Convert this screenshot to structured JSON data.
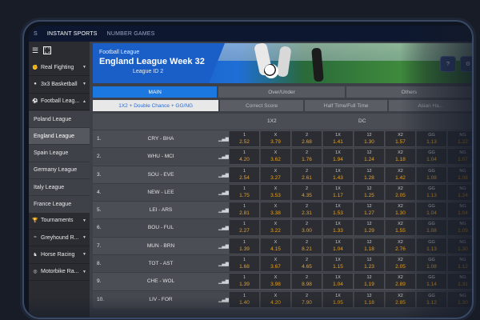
{
  "topbar": {
    "tabs": [
      {
        "label": "S"
      },
      {
        "label": "INSTANT SPORTS"
      },
      {
        "label": "NUMBER GAMES"
      }
    ]
  },
  "sidebar": {
    "items": [
      {
        "label": "Real Fighting",
        "icon": "fist-icon",
        "kind": "sport"
      },
      {
        "label": "3x3 Basketball",
        "icon": "basketball-icon",
        "kind": "sport"
      },
      {
        "label": "Football Leag...",
        "icon": "football-icon",
        "kind": "sport"
      },
      {
        "label": "Poland League",
        "kind": "sub"
      },
      {
        "label": "England League",
        "kind": "sub-active"
      },
      {
        "label": "Spain League",
        "kind": "sub"
      },
      {
        "label": "Germany League",
        "kind": "sub"
      },
      {
        "label": "Italy League",
        "kind": "sub"
      },
      {
        "label": "France League",
        "kind": "sub"
      },
      {
        "label": "Tournaments",
        "icon": "trophy-icon",
        "kind": "sport"
      },
      {
        "label": "Greyhound R...",
        "icon": "greyhound-icon",
        "kind": "sport"
      },
      {
        "label": "Horse Racing",
        "icon": "horse-icon",
        "kind": "sport"
      },
      {
        "label": "Motorbike Ra...",
        "icon": "motorbike-icon",
        "kind": "sport"
      }
    ]
  },
  "banner": {
    "subtitle": "Football League",
    "title": "England League Week 32",
    "league_id": "League ID 2",
    "help_label": "?"
  },
  "main_tabs": [
    {
      "label": "MAIN"
    },
    {
      "label": "Over/Under"
    },
    {
      "label": "Others"
    }
  ],
  "sub_tabs": [
    {
      "label": "1X2 + Double Chance + GG/NG"
    },
    {
      "label": "Correct Score"
    },
    {
      "label": "Half Time/Full Time"
    },
    {
      "label": "Asian Ha..."
    }
  ],
  "grid": {
    "headers": {
      "g1": "1X2",
      "g2": "DC"
    },
    "rows": [
      {
        "num": "1.",
        "match": "CRY - BHA",
        "odds": [
          "2.52",
          "3.79",
          "2.68",
          "1.41",
          "1.30",
          "1.57",
          "1.13",
          "1.22"
        ],
        "labels": [
          "1",
          "X",
          "2",
          "1X",
          "12",
          "X2",
          "GG",
          "NG"
        ]
      },
      {
        "num": "2.",
        "match": "WHU - MCI",
        "odds": [
          "4.20",
          "3.62",
          "1.76",
          "1.94",
          "1.24",
          "1.18",
          "1.04",
          "1.07"
        ],
        "labels": [
          "1",
          "X",
          "2",
          "1X",
          "12",
          "X2",
          "GG",
          "NG"
        ]
      },
      {
        "num": "3.",
        "match": "SOU - EVE",
        "odds": [
          "2.54",
          "3.27",
          "2.61",
          "1.43",
          "1.28",
          "1.42",
          "1.08",
          "1.08"
        ],
        "labels": [
          "1",
          "X",
          "2",
          "1X",
          "12",
          "X2",
          "GG",
          "NG"
        ]
      },
      {
        "num": "4.",
        "match": "NEW - LEE",
        "odds": [
          "1.75",
          "3.53",
          "4.35",
          "1.17",
          "1.25",
          "2.05",
          "1.13",
          "1.24"
        ],
        "labels": [
          "1",
          "X",
          "2",
          "1X",
          "12",
          "X2",
          "GG",
          "NG"
        ]
      },
      {
        "num": "5.",
        "match": "LEI - ARS",
        "odds": [
          "2.81",
          "3.38",
          "2.31",
          "1.53",
          "1.27",
          "1.30",
          "1.04",
          "1.04"
        ],
        "labels": [
          "1",
          "X",
          "2",
          "1X",
          "12",
          "X2",
          "GG",
          "NG"
        ]
      },
      {
        "num": "6.",
        "match": "BOU - FUL",
        "odds": [
          "2.27",
          "3.22",
          "3.00",
          "1.33",
          "1.29",
          "1.55",
          "1.08",
          "1.09"
        ],
        "labels": [
          "1",
          "X",
          "2",
          "1X",
          "12",
          "X2",
          "GG",
          "NG"
        ]
      },
      {
        "num": "7.",
        "match": "MUN - BRN",
        "odds": [
          "1.39",
          "4.15",
          "8.21",
          "1.04",
          "1.18",
          "2.76",
          "1.13",
          "1.30"
        ],
        "labels": [
          "1",
          "X",
          "2",
          "1X",
          "12",
          "X2",
          "GG",
          "NG"
        ]
      },
      {
        "num": "8.",
        "match": "TOT - AST",
        "odds": [
          "1.68",
          "3.67",
          "4.65",
          "1.15",
          "1.23",
          "2.05",
          "1.08",
          "1.12"
        ],
        "labels": [
          "1",
          "X",
          "2",
          "1X",
          "12",
          "X2",
          "GG",
          "NG"
        ]
      },
      {
        "num": "9.",
        "match": "CHE - WOL",
        "odds": [
          "1.39",
          "3.98",
          "8.98",
          "1.04",
          "1.19",
          "2.89",
          "1.14",
          "1.31"
        ],
        "labels": [
          "1",
          "X",
          "2",
          "1X",
          "12",
          "X2",
          "GG",
          "NG"
        ]
      },
      {
        "num": "10.",
        "match": "LIV - FOR",
        "odds": [
          "1.40",
          "4.20",
          "7.90",
          "1.05",
          "1.18",
          "2.85",
          "1.12",
          "1.30"
        ],
        "labels": [
          "1",
          "X",
          "2",
          "1X",
          "12",
          "X2",
          "GG",
          "NG"
        ]
      }
    ]
  },
  "colors": {
    "accent": "#1b78e0",
    "odds": "#e8a020",
    "banner": "#1a5fc8"
  }
}
